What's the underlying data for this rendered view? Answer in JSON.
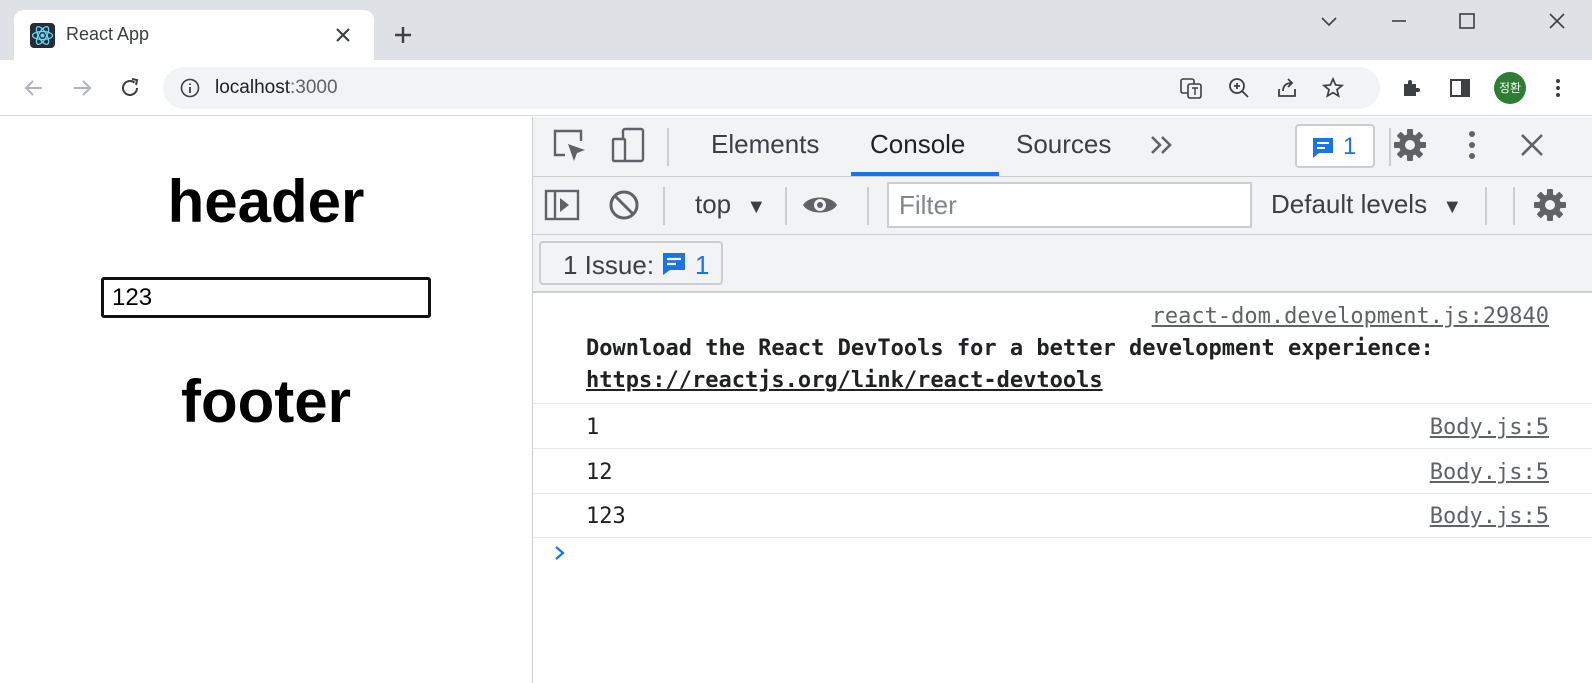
{
  "browser": {
    "tab_title": "React App",
    "url_host": "localhost",
    "url_port": ":3000",
    "profile_initials": "정환"
  },
  "page": {
    "header": "header",
    "input_value": "123",
    "footer": "footer"
  },
  "devtools": {
    "tabs": [
      "Elements",
      "Console",
      "Sources"
    ],
    "active_tab": "Console",
    "issues_badge_count": "1",
    "context": "top",
    "filter_placeholder": "Filter",
    "levels": "Default levels",
    "issues_label": "1 Issue:",
    "issues_count": "1",
    "messages": [
      {
        "source": "react-dom.development.js:29840",
        "text": "Download the React DevTools for a better development experience:",
        "link": "https://reactjs.org/link/react-devtools"
      },
      {
        "text": "1",
        "source": "Body.js:5"
      },
      {
        "text": "12",
        "source": "Body.js:5"
      },
      {
        "text": "123",
        "source": "Body.js:5"
      }
    ]
  },
  "colors": {
    "accent": "#1a73e8",
    "tabstrip": "#dee1e6",
    "devtools_bar": "#f1f3f4"
  }
}
